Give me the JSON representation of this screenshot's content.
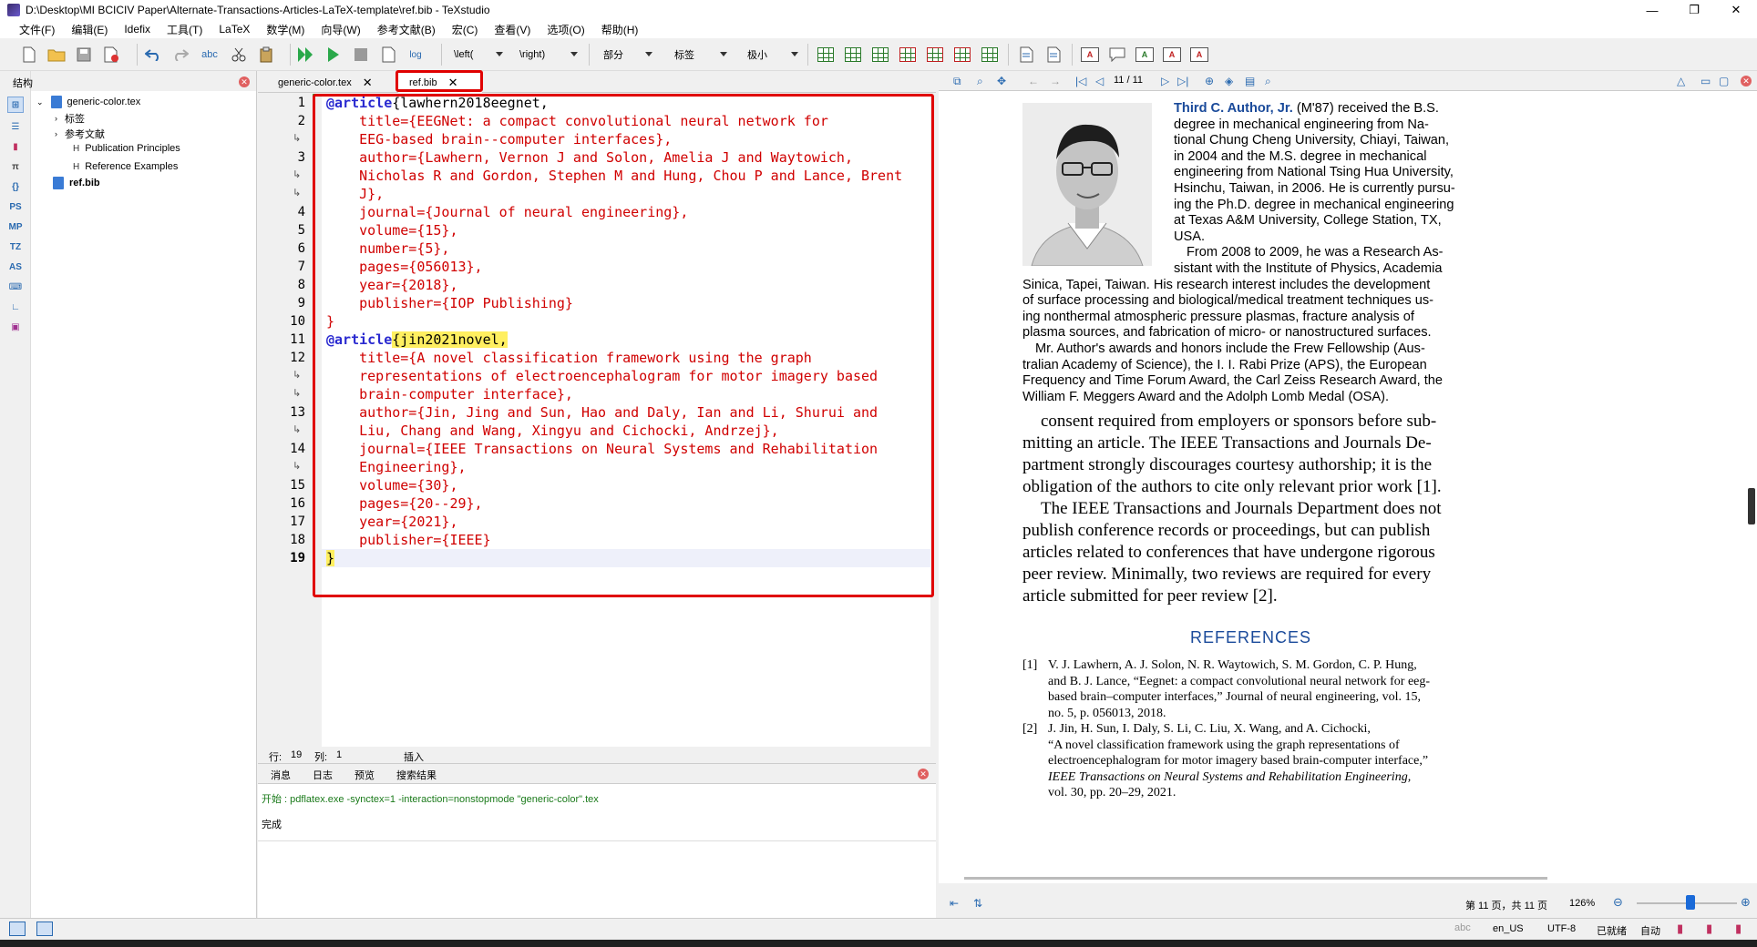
{
  "window": {
    "title": "D:\\Desktop\\MI BCICIV Paper\\Alternate-Transactions-Articles-LaTeX-template\\ref.bib - TeXstudio",
    "min": "—",
    "max": "❐",
    "close": "✕"
  },
  "menu": [
    "文件(F)",
    "编辑(E)",
    "Idefix",
    "工具(T)",
    "LaTeX",
    "数学(M)",
    "向导(W)",
    "参考文献(B)",
    "宏(C)",
    "查看(V)",
    "选项(O)",
    "帮助(H)"
  ],
  "toolbar": {
    "left_combo": "\\left(",
    "right_combo": "\\right)",
    "section_combo": "部分",
    "label_combo": "标签",
    "size_combo": "极小",
    "log_label": "log"
  },
  "rail": [
    "PS",
    "MP",
    "TZ",
    "AS"
  ],
  "structure": {
    "header": "结构",
    "items": [
      {
        "label": "generic-color.tex"
      },
      {
        "label": "标签"
      },
      {
        "label": "参考文献"
      },
      {
        "label": "Publication Principles"
      },
      {
        "label": "Reference Examples"
      },
      {
        "label": "ref.bib"
      }
    ],
    "heading_marker": "H"
  },
  "tabs": [
    {
      "label": "generic-color.tex"
    },
    {
      "label": "ref.bib"
    }
  ],
  "editor": {
    "line_numbers": [
      "1",
      "2",
      "3",
      "4",
      "5",
      "6",
      "7",
      "8",
      "9",
      "10",
      "11",
      "12",
      "13",
      "14",
      "15",
      "16",
      "17",
      "18",
      "19"
    ],
    "lines": [
      {
        "kw": "@article",
        "plain": "{lawhern2018eegnet,",
        "red": ""
      },
      {
        "kw": "",
        "plain": "",
        "red": "    title={EEGNet: a compact convolutional neural network for"
      },
      {
        "kw": "",
        "plain": "",
        "red": "    EEG-based brain--computer interfaces},"
      },
      {
        "kw": "",
        "plain": "",
        "red": "    author={Lawhern, Vernon J and Solon, Amelia J and Waytowich,"
      },
      {
        "kw": "",
        "plain": "",
        "red": "    Nicholas R and Gordon, Stephen M and Hung, Chou P and Lance, Brent"
      },
      {
        "kw": "",
        "plain": "",
        "red": "    J},"
      },
      {
        "kw": "",
        "plain": "",
        "red": "    journal={Journal of neural engineering},"
      },
      {
        "kw": "",
        "plain": "",
        "red": "    volume={15},"
      },
      {
        "kw": "",
        "plain": "",
        "red": "    number={5},"
      },
      {
        "kw": "",
        "plain": "",
        "red": "    pages={056013},"
      },
      {
        "kw": "",
        "plain": "",
        "red": "    year={2018},"
      },
      {
        "kw": "",
        "plain": "",
        "red": "    publisher={IOP Publishing}"
      },
      {
        "kw": "",
        "plain": "",
        "red": "}"
      },
      {
        "kw": "@article",
        "plain": "{jin2021novel,",
        "red": ""
      },
      {
        "kw": "",
        "plain": "",
        "red": "    title={A novel classification framework using the graph"
      },
      {
        "kw": "",
        "plain": "",
        "red": "    representations of electroencephalogram for motor imagery based"
      },
      {
        "kw": "",
        "plain": "",
        "red": "    brain-computer interface},"
      },
      {
        "kw": "",
        "plain": "",
        "red": "    author={Jin, Jing and Sun, Hao and Daly, Ian and Li, Shurui and"
      },
      {
        "kw": "",
        "plain": "",
        "red": "    Liu, Chang and Wang, Xingyu and Cichocki, Andrzej},"
      },
      {
        "kw": "",
        "plain": "",
        "red": "    journal={IEEE Transactions on Neural Systems and Rehabilitation"
      },
      {
        "kw": "",
        "plain": "",
        "red": "    Engineering},"
      },
      {
        "kw": "",
        "plain": "",
        "red": "    volume={30},"
      },
      {
        "kw": "",
        "plain": "",
        "red": "    pages={20--29},"
      },
      {
        "kw": "",
        "plain": "",
        "red": "    year={2021},"
      },
      {
        "kw": "",
        "plain": "",
        "red": "    publisher={IEEE}"
      },
      {
        "kw": "",
        "plain": "}",
        "red": ""
      }
    ],
    "wrap_marker": "↳"
  },
  "cursor_status": {
    "line_label": "行:",
    "line": "19",
    "col_label": "列:",
    "col": "1",
    "mode": "插入"
  },
  "messages": {
    "tabs": [
      "消息",
      "日志",
      "预览",
      "搜索结果"
    ],
    "command": "开始 : pdflatex.exe -synctex=1 -interaction=nonstopmode \"generic-color\".tex",
    "result": "完成"
  },
  "pdf": {
    "page_display": "11 / 11",
    "bio_name": "Third C. Author, Jr.",
    "bio_lines": [
      " (M'87) received the B.S.",
      "degree in mechanical engineering from Na-",
      "tional Chung Cheng University, Chiayi, Taiwan,",
      "in 2004 and the M.S. degree in mechanical",
      "engineering from National Tsing Hua University,",
      "Hsinchu, Taiwan, in 2006. He is currently pursu-",
      "ing the Ph.D. degree in mechanical engineering",
      "at Texas A&M University, College Station, TX,",
      "USA.",
      "From 2008 to 2009, he was a Research As-",
      "sistant with the Institute of Physics, Academia"
    ],
    "bio_full_lines": [
      "Sinica, Tapei, Taiwan. His research interest includes the development",
      "of surface processing and biological/medical treatment techniques us-",
      "ing nonthermal atmospheric pressure plasmas, fracture analysis of",
      "plasma sources, and fabrication of micro- or nanostructured surfaces.",
      "Mr. Author's awards and honors include the Frew Fellowship (Aus-",
      "tralian Academy of Science), the I. I. Rabi Prize (APS), the European",
      "Frequency and Time Forum Award, the Carl Zeiss Research Award, the",
      "William F. Meggers Award and the Adolph Lomb Medal (OSA)."
    ],
    "body_lines": [
      "consent required from employers or sponsors before sub-",
      "mitting an article. The IEEE Transactions and Journals De-",
      "partment strongly discourages courtesy authorship; it is the",
      "obligation of the authors to cite only relevant prior work [1].",
      "The IEEE Transactions and Journals Department does not",
      "publish conference records or proceedings, but can publish",
      "articles related to conferences that have undergone rigorous",
      "peer review. Minimally, two reviews are required for every",
      "article submitted for peer review [2]."
    ],
    "references_heading": "REFERENCES",
    "refs": [
      {
        "num": "[1]",
        "lines": [
          "V. J. Lawhern, A. J. Solon, N. R. Waytowich, S. M. Gordon, C. P. Hung,",
          "and B. J. Lance, “Eegnet: a compact convolutional neural network for eeg-",
          "based brain–computer interfaces,” Journal of neural engineering, vol. 15,",
          "no. 5, p. 056013, 2018."
        ]
      },
      {
        "num": "[2]",
        "lines": [
          "J. Jin, H. Sun, I. Daly, S. Li, C. Liu, X. Wang, and A. Cichocki,",
          "“A novel classification framework using the graph representations of",
          "electroencephalogram for motor imagery based brain-computer interface,”",
          "IEEE Transactions on Neural Systems and Rehabilitation Engineering,",
          "vol. 30, pp. 20–29, 2021."
        ]
      }
    ],
    "page_status": "第 11 页，共 11 页",
    "zoom": "126%"
  },
  "status_bar": {
    "lang": "en_US",
    "encoding": "UTF-8",
    "saved": "已就绪",
    "auto": "自动"
  },
  "colors": {
    "accent_red": "#e00000",
    "keyword_blue": "#2a2ad0",
    "value_red": "#d00000",
    "ref_heading": "#1a4a9a"
  }
}
